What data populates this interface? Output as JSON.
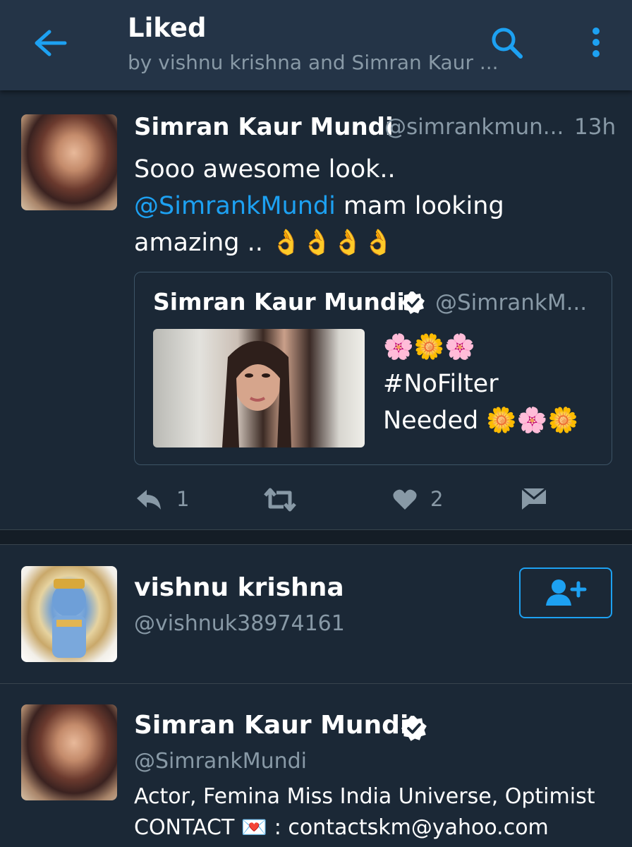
{
  "header": {
    "title": "Liked",
    "subtitle": "by vishnu krishna and Simran Kaur ..."
  },
  "tweet": {
    "name": "Simran Kaur Mundi",
    "handle": "@simrankmun...",
    "time": "13h",
    "text_line1": "Sooo awesome look..",
    "mention": "@SimrankMundi",
    "text_rest": " mam looking amazing .. 👌👌👌👌",
    "quote": {
      "name": "Simran Kaur Mundi",
      "handle": "@SimrankM...",
      "text_line1": "🌸🌼🌸",
      "text_line2": "#NoFilter",
      "text_line3": "Needed 🌼🌸🌼"
    },
    "actions": {
      "reply_count": "1",
      "like_count": "2"
    }
  },
  "users": [
    {
      "name": "vishnu krishna",
      "handle": "@vishnuk38974161"
    },
    {
      "name": "Simran Kaur Mundi",
      "handle": "@SimrankMundi",
      "bio_line1": "Actor, Femina Miss India Universe, Optimist",
      "bio_line2": "CONTACT 💌 : contactskm@yahoo.com"
    }
  ],
  "colors": {
    "background": "#1b2836",
    "header": "#243447",
    "accent": "#1da1f2",
    "secondary_text": "#8899a6"
  },
  "icons": [
    "back-arrow-icon",
    "search-icon",
    "more-vertical-icon",
    "verified-icon",
    "reply-icon",
    "retweet-icon",
    "heart-icon",
    "direct-message-icon",
    "follow-user-icon"
  ]
}
